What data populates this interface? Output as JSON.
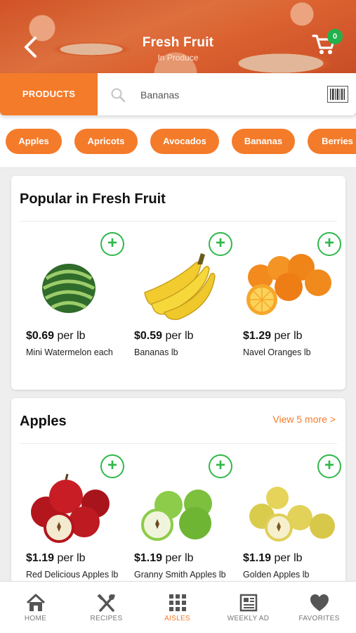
{
  "header": {
    "title": "Fresh Fruit",
    "subtitle": "In Produce",
    "cart_count": "0"
  },
  "search": {
    "tab_label": "PRODUCTS",
    "value": "Bananas"
  },
  "categories": [
    "Apples",
    "Apricots",
    "Avocados",
    "Bananas",
    "Berries"
  ],
  "popular": {
    "title": "Popular in Fresh Fruit",
    "products": [
      {
        "price": "$0.69",
        "unit": "per lb",
        "name": "Mini Watermelon each",
        "icon": "watermelon"
      },
      {
        "price": "$0.59",
        "unit": "per lb",
        "name": "Bananas lb",
        "icon": "bananas"
      },
      {
        "price": "$1.29",
        "unit": "per lb",
        "name": "Navel Oranges lb",
        "icon": "oranges"
      }
    ]
  },
  "apples": {
    "title": "Apples",
    "view_more": "View 5 more >",
    "products": [
      {
        "price": "$1.19",
        "unit": "per lb",
        "name": "Red Delicious Apples lb",
        "icon": "red-apples"
      },
      {
        "price": "$1.19",
        "unit": "per lb",
        "name": "Granny Smith Apples lb",
        "icon": "green-apples"
      },
      {
        "price": "$1.19",
        "unit": "per lb",
        "name": "Golden Apples lb",
        "icon": "golden-apples"
      }
    ]
  },
  "nav": [
    {
      "label": "HOME",
      "icon": "home-icon",
      "active": false
    },
    {
      "label": "RECIPES",
      "icon": "utensils-icon",
      "active": false
    },
    {
      "label": "AISLES",
      "icon": "grid-icon",
      "active": true
    },
    {
      "label": "WEEKLY AD",
      "icon": "newspaper-icon",
      "active": false
    },
    {
      "label": "FAVORITES",
      "icon": "heart-icon",
      "active": false
    }
  ],
  "colors": {
    "accent": "#f47b2a",
    "add_green": "#2fb84a",
    "badge_green": "#22b14c"
  }
}
